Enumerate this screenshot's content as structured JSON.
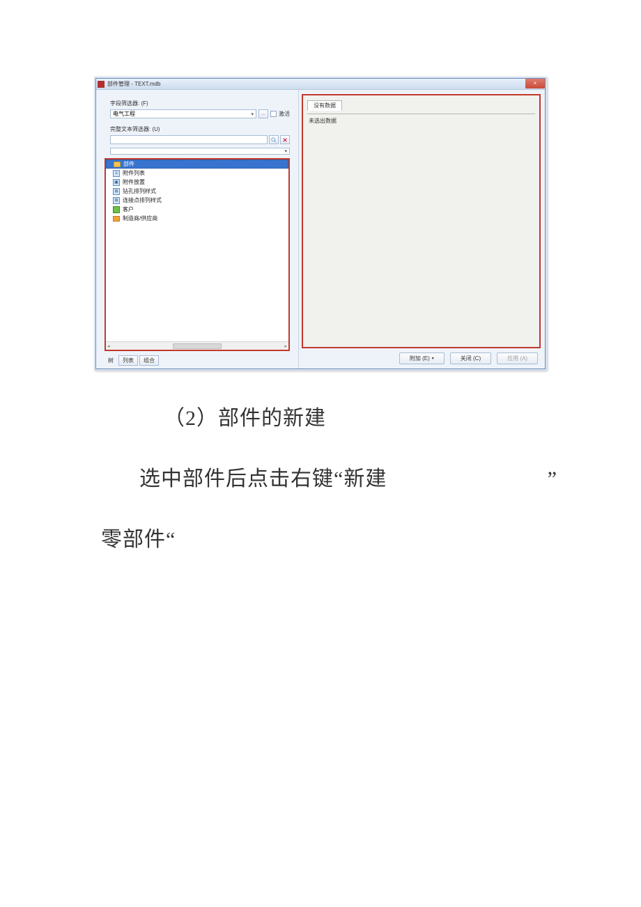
{
  "window": {
    "title": "部件管理 - TEXT.mdb",
    "close_glyph": "×"
  },
  "left": {
    "filter_label": "字段筛选器: (F)",
    "filter_value": "电气工程",
    "filter_ellipsis": "...",
    "filter_checkbox_label": "激活",
    "fulltext_label": "完整文本筛选器: (U)",
    "tree": [
      {
        "icon": "folder",
        "label": "部件",
        "selected": true
      },
      {
        "icon": "bluebox",
        "label": "附件列表"
      },
      {
        "icon": "bluebox",
        "label": "附件放置"
      },
      {
        "icon": "bluebox",
        "label": "钻孔排列样式"
      },
      {
        "icon": "bluebox",
        "label": "连接点排列样式"
      },
      {
        "icon": "green",
        "label": "客户"
      },
      {
        "icon": "orange",
        "label": "制造商/供应商"
      }
    ],
    "toggle": {
      "tree": "树",
      "list": "列表",
      "combo": "组合"
    }
  },
  "right": {
    "tab_label": "没有数据",
    "message": "未选出数据"
  },
  "buttons": {
    "extra": "附加 (E)",
    "close": "关闭 (C)",
    "apply": "应用 (A)"
  },
  "doc": {
    "line1": "（2）部件的新建",
    "line2_main": "选中部件后点击右键“新建",
    "line2_end_quote": "”",
    "line3": "零部件“"
  }
}
